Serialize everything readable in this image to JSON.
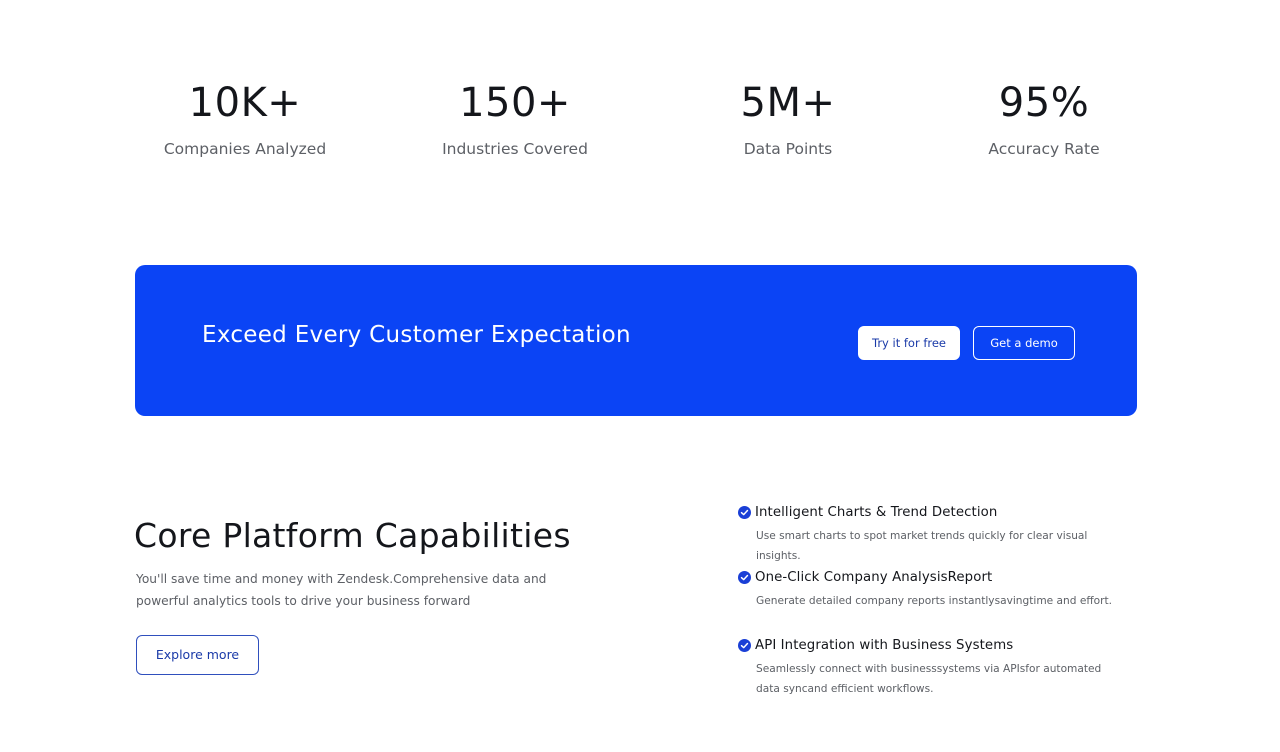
{
  "stats": [
    {
      "value": "10K+",
      "label": "Companies Analyzed"
    },
    {
      "value": "150+",
      "label": "Industries Covered"
    },
    {
      "value": "5M+",
      "label": "Data Points"
    },
    {
      "value": "95%",
      "label": "Accuracy Rate"
    }
  ],
  "cta": {
    "title": "Exceed Every Customer Expectation",
    "primary_label": "Try it for free",
    "secondary_label": "Get a demo",
    "background_color": "#0b44f5"
  },
  "capabilities": {
    "title": "Core Platform Capabilities",
    "description": "You'll save time and money with Zendesk.Comprehensive data and powerful analytics tools to drive your business forward",
    "button_label": "Explore more",
    "features": [
      {
        "icon": "check-circle-icon",
        "title": "Intelligent Charts & Trend Detection",
        "description": "Use smart charts to spot market trends quickly for clear visual insights."
      },
      {
        "icon": "check-circle-icon",
        "title": "One-Click Company AnalysisReport",
        "description": "Generate detailed company reports instantlysavingtime and effort."
      },
      {
        "icon": "check-circle-icon",
        "title": "API Integration with Business Systems",
        "description": "Seamlessly connect with businesssystems via APIsfor automated data syncand efficient workflows."
      }
    ]
  },
  "colors": {
    "accent": "#0b44f5",
    "check_icon": "#1a3fd6",
    "text_dark": "#14161b",
    "text_muted": "#5d6066"
  }
}
